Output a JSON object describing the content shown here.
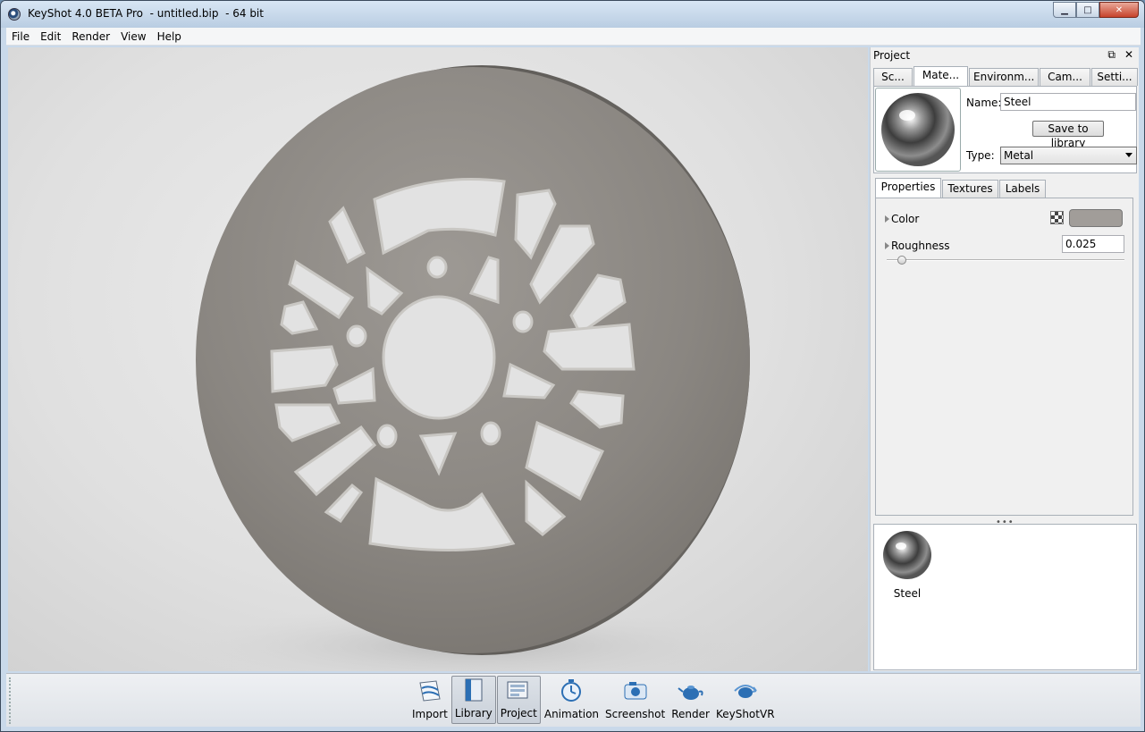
{
  "window": {
    "title": "KeyShot 4.0 BETA Pro  - untitled.bip  - 64 bit",
    "controls": {
      "minimize": "▁",
      "maximize": "□",
      "close": "✕"
    }
  },
  "menubar": {
    "items": [
      {
        "label": "File"
      },
      {
        "label": "Edit"
      },
      {
        "label": "Render"
      },
      {
        "label": "View"
      },
      {
        "label": "Help"
      }
    ]
  },
  "project_panel": {
    "title": "Project",
    "float_glyph": "⧉",
    "close_glyph": "✕",
    "tabs": [
      {
        "label": "Sc..."
      },
      {
        "label": "Mate..."
      },
      {
        "label": "Environm..."
      },
      {
        "label": "Cam..."
      },
      {
        "label": "Setti..."
      }
    ],
    "active_tab": "Mate...",
    "material": {
      "name_label": "Name:",
      "name_value": "Steel",
      "save_button": "Save to library",
      "type_label": "Type:",
      "type_value": "Metal"
    },
    "sub_tabs": [
      {
        "label": "Properties"
      },
      {
        "label": "Textures"
      },
      {
        "label": "Labels"
      }
    ],
    "active_sub_tab": "Properties",
    "properties": {
      "color_label": "Color",
      "color_value": "#a19d99",
      "roughness_label": "Roughness",
      "roughness_value": "0.025"
    },
    "splitter": "•••",
    "library_items": [
      {
        "label": "Steel"
      }
    ]
  },
  "toolbar": {
    "buttons": [
      {
        "label": "Import",
        "icon": "import-icon"
      },
      {
        "label": "Library",
        "icon": "library-icon"
      },
      {
        "label": "Project",
        "icon": "project-icon"
      },
      {
        "label": "Animation",
        "icon": "animation-icon"
      },
      {
        "label": "Screenshot",
        "icon": "screenshot-icon"
      },
      {
        "label": "Render",
        "icon": "render-teapot-icon"
      },
      {
        "label": "KeyShotVR",
        "icon": "keyshotvr-icon"
      }
    ],
    "pressed": [
      "Library",
      "Project"
    ]
  },
  "colors": {
    "viewport_bg": "#e2e2e2",
    "disc_metal": "#8f8b87",
    "accent_blue": "#2c6fb4"
  }
}
